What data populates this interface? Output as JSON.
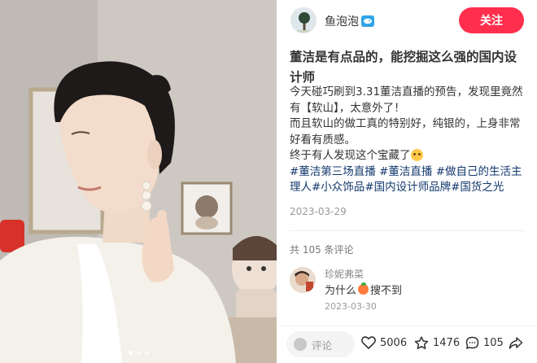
{
  "post": {
    "author": {
      "name": "鱼泡泡",
      "avatar": "avatar-image",
      "badge": "fish-badge-icon"
    },
    "follow_label": "关注",
    "title": "董洁是有点品的，能挖掘这么强的国内设计师",
    "body_lines": [
      "今天碰巧刷到3.31董洁直播的预告，发现里竟然有【软山】，太意外了！",
      "而且软山的做工真的特别好，纯银的，上身非常好看有质感。",
      "终于有人发现这个宝藏了"
    ],
    "body_emoji": "crying-face-emoji",
    "tags": [
      "#董洁第三场直播",
      "#董洁直播",
      "#做自己的生活主理人",
      "#小众饰品",
      "#国内设计师品牌",
      "#国货之光"
    ],
    "date": "2023-03-29",
    "comment_count_label": "共 105 条评论"
  },
  "comment": {
    "user": "珍妮弗菜",
    "text": "为什么",
    "emoji": "peach-emoji",
    "text_after": "搜不到",
    "date": "2023-03-30"
  },
  "footer": {
    "comment_placeholder": "评论",
    "likes": "5006",
    "favorites": "1476",
    "comments": "105"
  },
  "photo": {
    "description_icon": "photo-image",
    "slide_count": 3,
    "active_slide": 1
  },
  "colors": {
    "accent": "#ff2e4d",
    "tag": "#13386c"
  }
}
